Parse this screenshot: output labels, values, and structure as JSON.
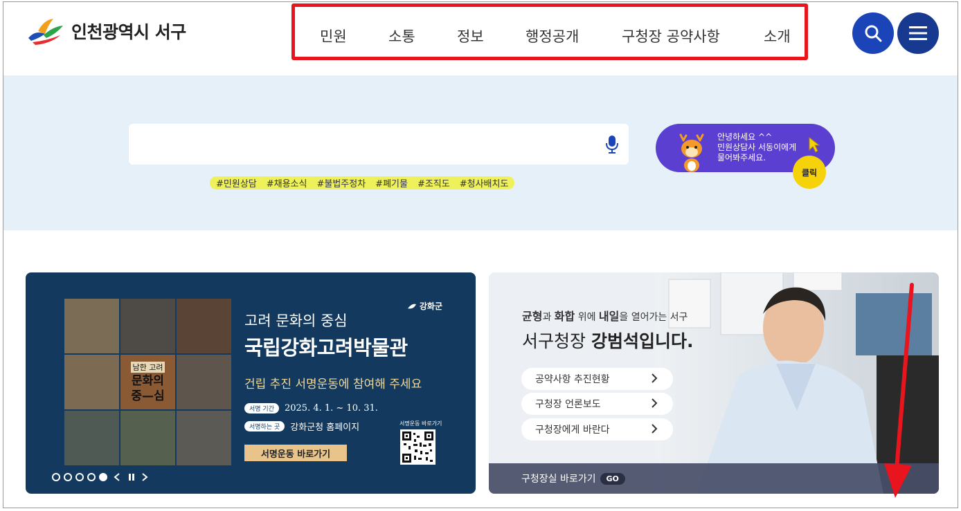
{
  "header": {
    "logo_text": "인천광역시 서구",
    "nav": [
      "민원",
      "소통",
      "정보",
      "행정공개",
      "구청장 공약사항",
      "소개"
    ],
    "search_icon": "search-icon",
    "menu_icon": "hamburger-menu-icon"
  },
  "search": {
    "input_value": "",
    "mic_icon": "microphone-icon",
    "tags": [
      "#민원상담",
      "#채용소식",
      "#불법주정차",
      "#폐기물",
      "#조직도",
      "#청사배치도"
    ]
  },
  "chatbot": {
    "line1": "안녕하세요 ^^",
    "line2": "민원상담사 서동이에게",
    "line3": "물어봐주세요.",
    "click_label": "클릭"
  },
  "banner_left": {
    "brand": "강화군",
    "tile_small": "남한 고려",
    "tile_big1": "문화의",
    "tile_big2": "중—심",
    "line1": "고려 문화의 중심",
    "line2": "국립강화고려박물관",
    "line3": "건립 추진 서명운동에 참여해 주세요",
    "period_label": "서명 기간",
    "period_value": "2025. 4. 1. ~ 10. 31.",
    "place_label": "서명하는 곳",
    "place_value": "강화군청 홈페이지",
    "cta": "서명운동 바로가기",
    "qr_label": "서명운동 바로가기",
    "slides_total": 5,
    "slide_active": 5
  },
  "banner_right": {
    "slogan_p1": "균형",
    "slogan_p2": "과 ",
    "slogan_p3": "화합",
    "slogan_p4": " 위에 ",
    "slogan_p5": "내일",
    "slogan_p6": "을 열어가는 서구",
    "title_pre": "서구청장 ",
    "title_name": "강범석",
    "title_post": "입니다.",
    "links": [
      "공약사항 추진현황",
      "구청장 언론보도",
      "구청장에게 바란다"
    ],
    "bottom_label": "구청장실 바로가기",
    "go_label": "GO"
  },
  "colors": {
    "accent_blue": "#1a44b8",
    "highlight_red": "#e8141e",
    "chat_purple": "#5b3fd0",
    "banner_navy": "#133a5e"
  }
}
